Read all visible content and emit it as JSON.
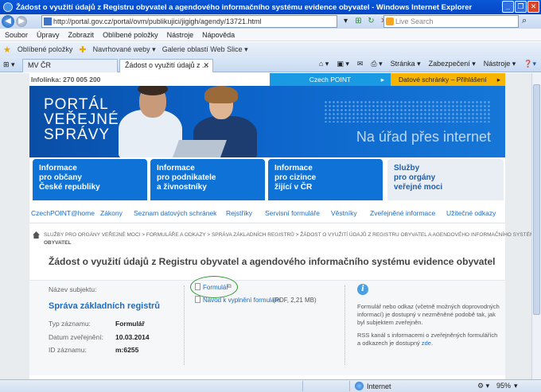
{
  "window": {
    "title": "Žádost o využití údajů z Registru obyvatel a agendového informačního systému evidence obyvatel - Windows Internet Explorer"
  },
  "addressbar": {
    "url": "http://portal.gov.cz/portal/ovm/publikujici/jigigh/agendy/13721.html",
    "search_placeholder": "Live Search"
  },
  "menu": [
    "Soubor",
    "Úpravy",
    "Zobrazit",
    "Oblíbené položky",
    "Nástroje",
    "Nápověda"
  ],
  "favorites": {
    "label": "Oblíbené položky",
    "items": [
      "Navrhované weby ▾",
      "Galerie oblastí Web Slice ▾"
    ]
  },
  "tabs": [
    "MV ČR",
    "Žádost o využití údajů z ..."
  ],
  "tab_tools": [
    "Stránka ▾",
    "Zabezpečení ▾",
    "Nástroje ▾"
  ],
  "site": {
    "infolinka": "Infolinka: 270 005 200",
    "czech_point": "Czech POINT",
    "datove_schranky": "Datové schránky – Přihlášení",
    "brand_lines": [
      "PORTÁL",
      "VEŘEJNÉ",
      "SPRÁVY"
    ],
    "slogan": "Na úřad přes internet",
    "tiles": [
      {
        "l1": "Informace",
        "l2": "pro občany",
        "l3": "České republiky"
      },
      {
        "l1": "Informace",
        "l2": "pro podnikatele",
        "l3": "a živnostníky"
      },
      {
        "l1": "Informace",
        "l2": "pro cizince",
        "l3": "žijící v ČR"
      },
      {
        "l1": "Služby",
        "l2": "pro orgány",
        "l3": "veřejné moci"
      }
    ],
    "navlinks": [
      "CzechPOINT@home",
      "Zákony",
      "Seznam datových schránek",
      "Rejstříky",
      "Servisní formuláře",
      "Věstníky",
      "Zveřejněné informace",
      "Užitečné odkazy"
    ],
    "breadcrumb_line1": "SLUŽBY PRO ORGÁNY VEŘEJNÉ MOCI   >  FORMULÁŘE A ODKAZY   >  SPRÁVA ZÁKLADNÍCH REGISTRŮ   >  ŽÁDOST O VYUŽITÍ ÚDAJŮ Z REGISTRU OBYVATEL A AGENDOVÉHO INFORMAČNÍHO SYSTÉMU EVIDENCE",
    "breadcrumb_line2": "OBYVATEL",
    "page_title": "Žádost o využití údajů z Registru obyvatel a agendového informačního systému evidence obyvatel",
    "detail": {
      "subject_label": "Název subjektu:",
      "subject_value": "Správa základních registrů",
      "typ_label": "Typ záznamu:",
      "typ_value": "Formulář",
      "datum_label": "Datum zveřejnění:",
      "datum_value": "10.03.2014",
      "id_label": "ID záznamu:",
      "id_value": "m:6255",
      "link_formular": "Formulář",
      "link_navod": "Návod k vyplnění formuláře",
      "link_navod_meta": "(PDF, 2,21 MB)",
      "info_p1": "Formulář nebo odkaz (včetně možných doprovodných informací) je dostupný v nezměněné podobě tak, jak byl subjektem zveřejněn.",
      "info_p2_pre": "RSS kanál s informacemi o zveřejněných formulářích a odkazech je dostupný ",
      "info_p2_link": "zde",
      "info_p2_post": "."
    }
  },
  "status": {
    "zone": "Internet",
    "zoom": "95%"
  }
}
